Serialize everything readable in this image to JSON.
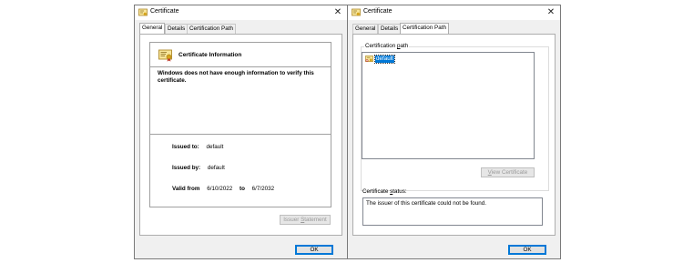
{
  "dialogs": [
    {
      "title": "Certificate",
      "tabs": [
        "General",
        "Details",
        "Certification Path"
      ],
      "active_tab": "General",
      "general": {
        "heading": "Certificate Information",
        "warning": "Windows does not have enough information to verify this certificate.",
        "issued_to_label": "Issued to:",
        "issued_to": "default",
        "issued_by_label": "Issued by:",
        "issued_by": "default",
        "valid_from_label": "Valid from",
        "valid_from": "6/10/2022",
        "valid_to_label": "to",
        "valid_to": "6/7/2032"
      },
      "issuer_statement_prefix": "Issuer ",
      "issuer_statement_mnemonic": "S",
      "issuer_statement_suffix": "tatement",
      "ok_label": "OK"
    },
    {
      "title": "Certificate",
      "tabs": [
        "General",
        "Details",
        "Certification Path"
      ],
      "active_tab": "Certification Path",
      "path": {
        "group_label_prefix": "Certification ",
        "group_label_mnemonic": "p",
        "group_label_suffix": "ath",
        "tree_item": "default",
        "view_cert_mnemonic": "V",
        "view_cert_suffix": "iew Certificate",
        "status_label_prefix": "Certificate ",
        "status_label_mnemonic": "s",
        "status_label_suffix": "tatus:",
        "status_text": "The issuer of this certificate could not be found."
      },
      "ok_label": "OK"
    }
  ],
  "colors": {
    "accent": "#0078d7",
    "dialog_bg": "#f0f0f0",
    "border": "#adadad"
  },
  "icons": {
    "title_icon": "certificate-icon",
    "close_icon": "close-icon",
    "tree_icon": "certificate-icon"
  }
}
